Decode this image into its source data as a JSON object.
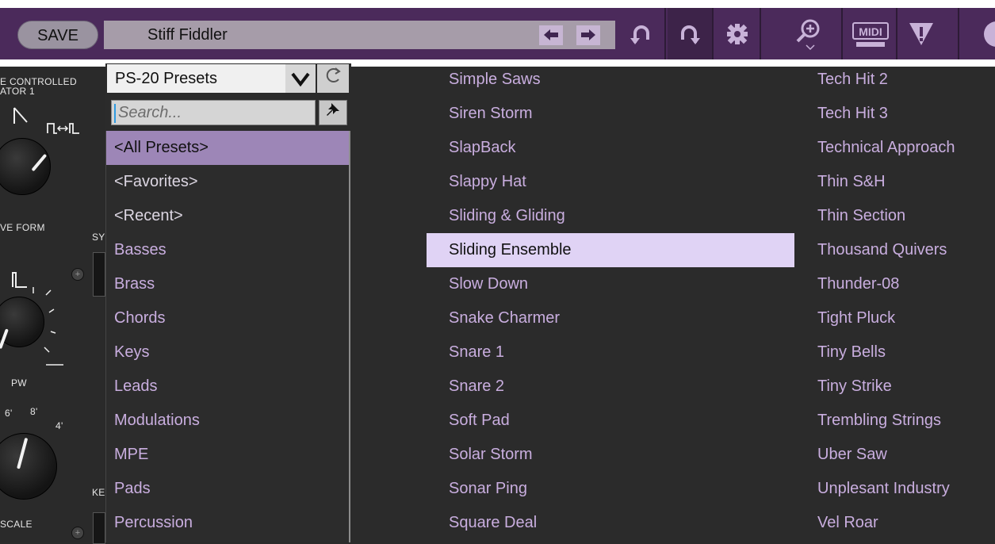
{
  "header": {
    "save_label": "SAVE",
    "preset_name": "Stiff Fiddler",
    "prev_arrow": "🡐",
    "next_arrow": "🡒",
    "icons": [
      "undo-icon",
      "redo-icon",
      "settings-gear-icon",
      "zoom-icon",
      "midi-icon",
      "warning-icon"
    ]
  },
  "panel": {
    "oscillator_label_line1": "E CONTROLLED",
    "oscillator_label_line2": "ATOR   1",
    "waveform_label": "VE FORM",
    "sync_label": "SY",
    "pw_label": "PW",
    "octave_labels": [
      "6'",
      "8'",
      "4'"
    ],
    "scale_label": "SCALE",
    "ke_label": "KE"
  },
  "category": {
    "selected": "PS-20 Presets",
    "search_placeholder": "Search...",
    "items": [
      {
        "label": "<All Presets>"
      },
      {
        "label": "<Favorites>"
      },
      {
        "label": "<Recent>"
      },
      {
        "label": "Basses"
      },
      {
        "label": "Brass"
      },
      {
        "label": "Chords"
      },
      {
        "label": "Keys"
      },
      {
        "label": "Leads"
      },
      {
        "label": "Modulations"
      },
      {
        "label": "MPE"
      },
      {
        "label": "Pads"
      },
      {
        "label": "Percussion"
      }
    ],
    "selected_index": 0
  },
  "presets": {
    "column1": [
      "Simple Saws",
      "Siren Storm",
      "SlapBack",
      "Slappy Hat",
      "Sliding & Gliding",
      "Sliding Ensemble",
      "Slow Down",
      "Snake Charmer",
      "Snare 1",
      "Snare 2",
      "Soft Pad",
      "Solar Storm",
      "Sonar Ping",
      "Square Deal"
    ],
    "column2": [
      "Tech Hit 2",
      "Tech Hit 3",
      "Technical Approach",
      "Thin S&H",
      "Thin Section",
      "Thousand Quivers",
      "Thunder-08",
      "Tight Pluck",
      "Tiny Bells",
      "Tiny Strike",
      "Trembling Strings",
      "Uber Saw",
      "Unplesant Industry",
      "Vel Roar"
    ],
    "highlighted": "Sliding Ensemble"
  },
  "colors": {
    "accent": "#4b2a5b",
    "list_text": "#c9aedf",
    "selected_bg": "#9d86b7",
    "highlight_bg": "#e0d3f5"
  }
}
